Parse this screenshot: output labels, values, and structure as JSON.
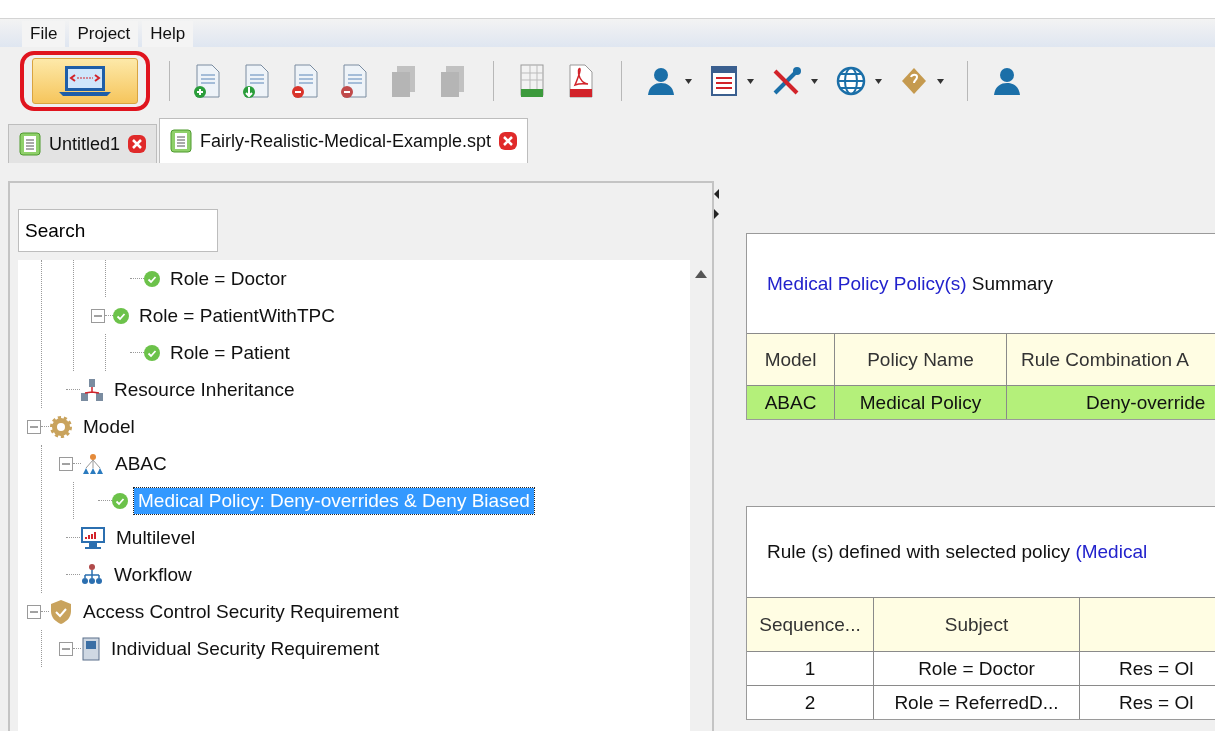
{
  "menu": [
    {
      "label": "File"
    },
    {
      "label": "Project"
    },
    {
      "label": "Help"
    }
  ],
  "toolbar": [
    {
      "kind": "editor",
      "highlighted": true
    },
    {
      "kind": "separator"
    },
    {
      "kind": "doc-add",
      "disabled": false,
      "dropdown": false
    },
    {
      "kind": "doc-import",
      "disabled": false,
      "dropdown": false
    },
    {
      "kind": "doc-remove",
      "disabled": false,
      "dropdown": false
    },
    {
      "kind": "doc-remove-grey",
      "disabled": false,
      "dropdown": false
    },
    {
      "kind": "doc-stack",
      "disabled": true,
      "dropdown": false
    },
    {
      "kind": "doc-stack",
      "disabled": true,
      "dropdown": false
    },
    {
      "kind": "separator"
    },
    {
      "kind": "xls",
      "disabled": false,
      "dropdown": false
    },
    {
      "kind": "pdf",
      "disabled": false,
      "dropdown": false
    },
    {
      "kind": "separator"
    },
    {
      "kind": "user",
      "disabled": false,
      "dropdown": true
    },
    {
      "kind": "form",
      "disabled": false,
      "dropdown": true
    },
    {
      "kind": "tools",
      "disabled": false,
      "dropdown": true
    },
    {
      "kind": "globe",
      "disabled": false,
      "dropdown": true
    },
    {
      "kind": "diamond",
      "disabled": false,
      "dropdown": true
    },
    {
      "kind": "separator"
    },
    {
      "kind": "user",
      "disabled": false,
      "dropdown": false
    }
  ],
  "tabs": [
    {
      "label": "Untitled1",
      "selected": false
    },
    {
      "label": "Fairly-Realistic-Medical-Example.spt",
      "selected": true
    }
  ],
  "search": {
    "value": "Search"
  },
  "tree": [
    {
      "children": [
        {
          "children": [
            {
              "children": [
                {
                  "label": "Role = Doctor",
                  "kind": "check",
                  "selected": false
                }
              ]
            },
            {
              "label": "Role = PatientWithTPC",
              "kind": "check",
              "selected": false,
              "expanded": true,
              "children": [
                {
                  "label": "Role = Patient",
                  "kind": "check",
                  "selected": false
                }
              ]
            }
          ]
        },
        {
          "label": "Resource Inheritance",
          "kind": "network",
          "selected": false
        }
      ]
    },
    {
      "label": "Model",
      "kind": "gear",
      "selected": false,
      "expanded": true,
      "children": [
        {
          "label": "ABAC",
          "kind": "hierarchy",
          "selected": false,
          "expanded": true,
          "children": [
            {
              "label": "Medical Policy: Deny-overrides & Deny Biased",
              "kind": "check",
              "selected": true
            }
          ]
        },
        {
          "label": "Multilevel",
          "kind": "monitor",
          "selected": false
        },
        {
          "label": "Workflow",
          "kind": "org",
          "selected": false
        }
      ]
    },
    {
      "label": "Access Control Security Requirement",
      "kind": "shield",
      "selected": false,
      "expanded": true,
      "children": [
        {
          "label": "Individual Security Requirement",
          "kind": "document",
          "selected": false,
          "expanded": true
        }
      ]
    }
  ],
  "summary": {
    "title_link": "Medical Policy Policy(s)",
    "title_rest": " Summary",
    "columns": [
      "Model",
      "Policy Name",
      "Rule Combination A"
    ],
    "rows": [
      {
        "cells": [
          "ABAC",
          "Medical Policy",
          "Deny-override"
        ],
        "highlighted": true
      }
    ]
  },
  "rules": {
    "title": "Rule (s) defined with selected policy ",
    "title_link": "(Medical",
    "columns": [
      "Sequence...",
      "Subject"
    ],
    "rows": [
      {
        "cells": [
          "1",
          "Role = Doctor",
          "Res = Ol"
        ]
      },
      {
        "cells": [
          "2",
          "Role = ReferredD...",
          "Res = Ol"
        ]
      }
    ]
  }
}
